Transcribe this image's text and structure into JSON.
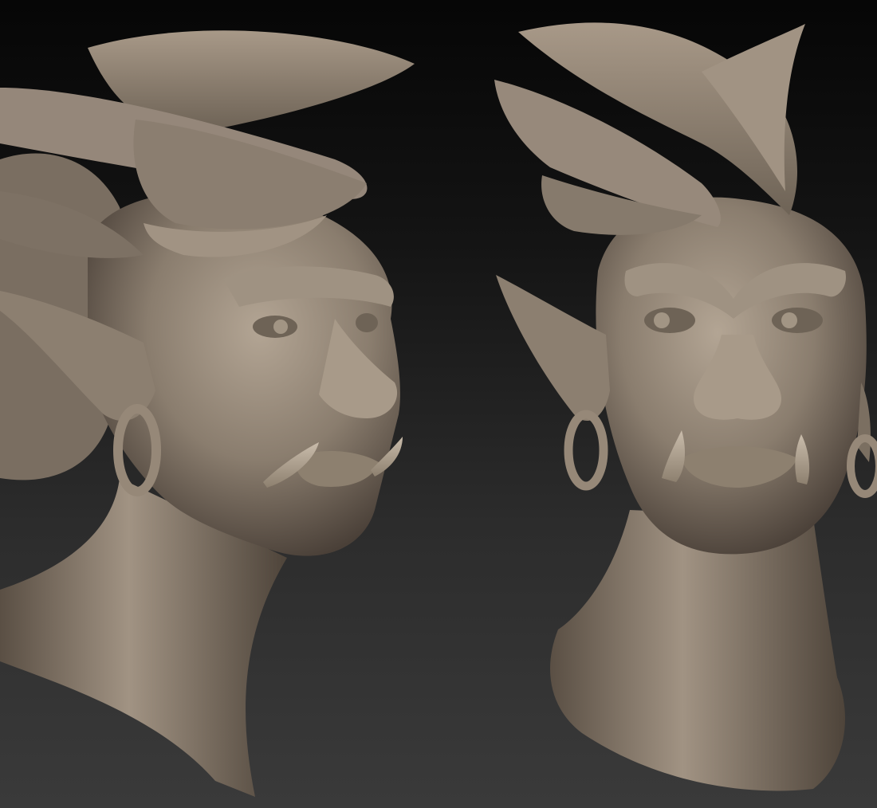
{
  "scene": {
    "background_top": "#060606",
    "background_bottom": "#3a3a3a",
    "clay_color": "#8a7d6e",
    "clay_highlight": "#b3a594",
    "clay_shadow": "#4a4038"
  },
  "sculpts": [
    {
      "subject": "orc-woman-bust",
      "view": "three-quarter"
    },
    {
      "subject": "orc-woman-bust",
      "view": "front"
    }
  ]
}
